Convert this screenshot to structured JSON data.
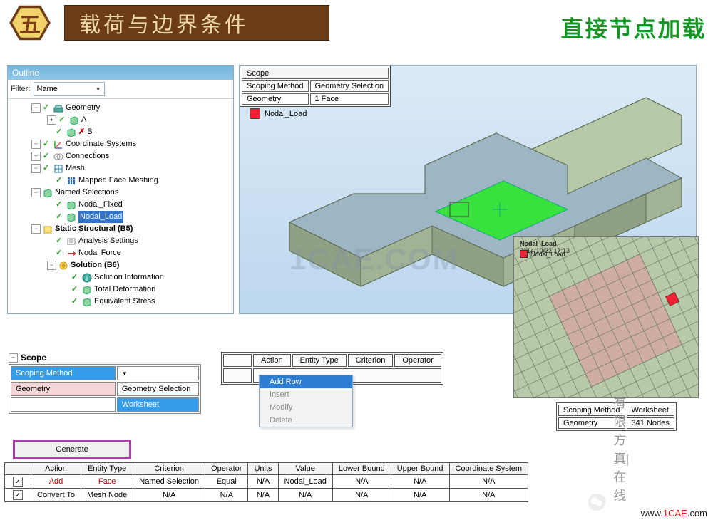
{
  "banner": {
    "hex": "五",
    "title": "载荷与边界条件",
    "subtitle": "直接节点加载"
  },
  "outline": {
    "title": "Outline",
    "filter_label": "Filter:",
    "filter_value": "Name"
  },
  "tree": {
    "geometry": "Geometry",
    "a": "A",
    "b": "B",
    "coord": "Coordinate Systems",
    "conn": "Connections",
    "mesh": "Mesh",
    "mapped": "Mapped Face Meshing",
    "ns": "Named Selections",
    "fixed": "Nodal_Fixed",
    "load": "Nodal_Load",
    "ss": "Static Structural (B5)",
    "as": "Analysis Settings",
    "nf": "Nodal Force",
    "sol": "Solution (B6)",
    "si": "Solution Information",
    "td": "Total Deformation",
    "es": "Equivalent Stress"
  },
  "scope_table": {
    "hdr": "Scope",
    "r1k": "Scoping Method",
    "r1v": "Geometry Selection",
    "r2k": "Geometry",
    "r2v": "1 Face"
  },
  "legend": "Nodal_Load",
  "watermark": "1CAE.COM",
  "inset": {
    "title": "Nodal_Load",
    "date": "2014/10/22 17:13",
    "legend": "Nodal_Load"
  },
  "scope2": {
    "title": "Scope",
    "r1": "Scoping Method",
    "r2": "Geometry",
    "opt1": "Geometry Selection",
    "opt2": "Worksheet"
  },
  "wsh": {
    "cols": [
      "Action",
      "Entity Type",
      "Criterion",
      "Operator"
    ]
  },
  "ctx": {
    "items": [
      "Add Row",
      "Insert",
      "Modify",
      "Delete"
    ]
  },
  "scope3": {
    "r1k": "Scoping Method",
    "r1v": "Worksheet",
    "r2k": "Geometry",
    "r2v": "341 Nodes"
  },
  "generate": "Generate",
  "bigtable": {
    "headers": [
      "",
      "Action",
      "Entity Type",
      "Criterion",
      "Operator",
      "Units",
      "Value",
      "Lower Bound",
      "Upper Bound",
      "Coordinate System"
    ],
    "rows": [
      {
        "chk": true,
        "action": "Add",
        "et": "Face",
        "cr": "Named Selection",
        "op": "Equal",
        "units": "N/A",
        "val": "Nodal_Load",
        "lb": "N/A",
        "ub": "N/A",
        "cs": "N/A"
      },
      {
        "chk": true,
        "action": "Convert To",
        "et": "Mesh Node",
        "cr": "N/A",
        "op": "N/A",
        "units": "N/A",
        "val": "N/A",
        "lb": "N/A",
        "ub": "N/A",
        "cs": "N/A"
      }
    ]
  },
  "brand": {
    "cn": "有限方真|在线",
    "url_1": "www.",
    "url_2": "1CAE",
    "url_3": ".com"
  }
}
